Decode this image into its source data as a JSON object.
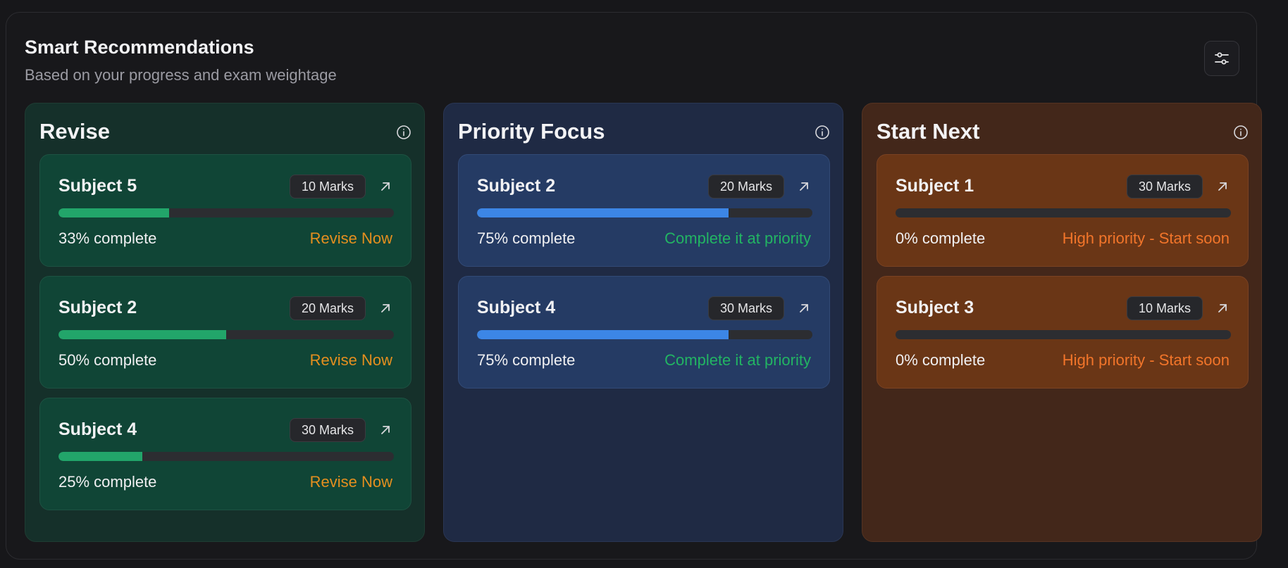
{
  "header": {
    "title": "Smart Recommendations",
    "subtitle": "Based on your progress and exam weightage",
    "filter_icon": "sliders-icon"
  },
  "columns": [
    {
      "title": "Revise",
      "info_icon": "info-icon",
      "cards": [
        {
          "subject": "Subject 5",
          "marks": "10 Marks",
          "progress": 33,
          "progress_label": "33% complete",
          "action": "Revise Now"
        },
        {
          "subject": "Subject 2",
          "marks": "20 Marks",
          "progress": 50,
          "progress_label": "50% complete",
          "action": "Revise Now"
        },
        {
          "subject": "Subject 4",
          "marks": "30 Marks",
          "progress": 25,
          "progress_label": "25% complete",
          "action": "Revise Now"
        }
      ]
    },
    {
      "title": "Priority Focus",
      "info_icon": "info-icon",
      "cards": [
        {
          "subject": "Subject 2",
          "marks": "20 Marks",
          "progress": 75,
          "progress_label": "75% complete",
          "action": "Complete it at priority"
        },
        {
          "subject": "Subject 4",
          "marks": "30 Marks",
          "progress": 75,
          "progress_label": "75% complete",
          "action": "Complete it at priority"
        }
      ]
    },
    {
      "title": "Start Next",
      "info_icon": "info-icon",
      "cards": [
        {
          "subject": "Subject 1",
          "marks": "30 Marks",
          "progress": 0,
          "progress_label": "0% complete",
          "action": "High priority - Start soon"
        },
        {
          "subject": "Subject 3",
          "marks": "10 Marks",
          "progress": 0,
          "progress_label": "0% complete",
          "action": "High priority - Start soon"
        }
      ]
    }
  ],
  "colors": {
    "revise_accent": "#22a56a",
    "priority_accent": "#3c86e6",
    "start_accent": "#d9772a"
  }
}
